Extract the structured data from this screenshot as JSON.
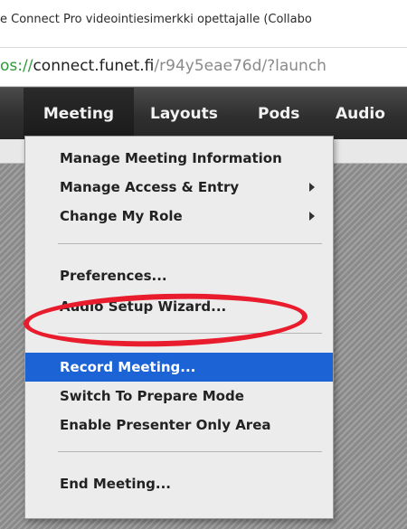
{
  "window": {
    "title": "e Connect Pro videointiesimerkki opettajalle (Collabo"
  },
  "address_bar": {
    "protocol": "os://",
    "domain": "connect.funet.fi",
    "path": "/r94y5eae76d/?launch"
  },
  "menubar": {
    "items": [
      {
        "label": "Meeting",
        "active": true
      },
      {
        "label": "Layouts",
        "active": false
      },
      {
        "label": "Pods",
        "active": false
      },
      {
        "label": "Audio",
        "active": false
      }
    ]
  },
  "meeting_menu": {
    "items": [
      {
        "label": "Manage Meeting Information",
        "has_submenu": false
      },
      {
        "label": "Manage Access & Entry",
        "has_submenu": true
      },
      {
        "label": "Change My Role",
        "has_submenu": true
      },
      {
        "label": "Preferences...",
        "has_submenu": false
      },
      {
        "label": "Audio Setup Wizard...",
        "has_submenu": false,
        "annotated": true
      },
      {
        "label": "Record Meeting...",
        "has_submenu": false,
        "highlighted": true
      },
      {
        "label": "Switch To Prepare Mode",
        "has_submenu": false
      },
      {
        "label": "Enable Presenter Only Area",
        "has_submenu": false
      },
      {
        "label": "End Meeting...",
        "has_submenu": false
      }
    ]
  },
  "colors": {
    "menubar": "#2f2f2f",
    "highlight": "#1c63d6",
    "annotation": "#e81c2c",
    "url_protocol": "#2e9a3c"
  }
}
